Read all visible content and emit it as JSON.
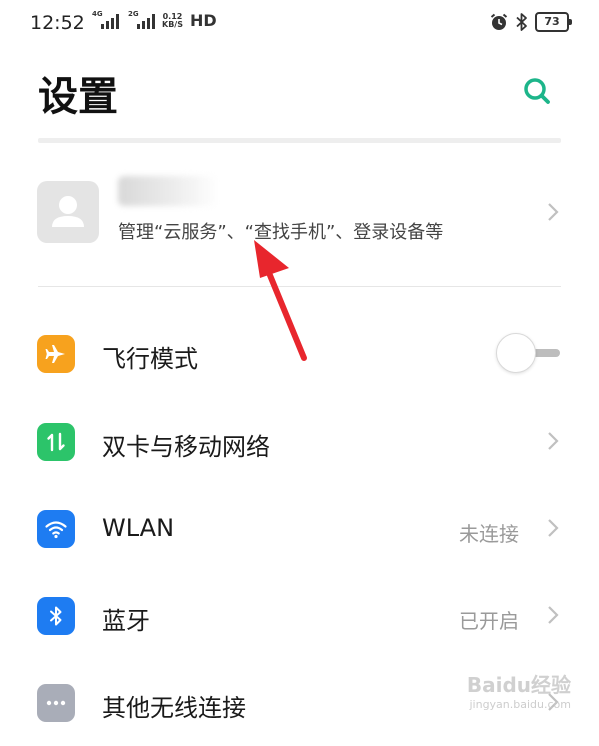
{
  "status_bar": {
    "time": "12:52",
    "sim1_tag": "4G",
    "sim2_tag": "2G",
    "speed_value": "0.12",
    "speed_unit": "KB/S",
    "hd": "HD",
    "battery": "73"
  },
  "header": {
    "title": "设置",
    "search_icon": "search-icon"
  },
  "account": {
    "avatar_icon": "person-icon",
    "subtitle": "管理“云服务”、“查找手机”、登录设备等"
  },
  "settings": [
    {
      "id": "airplane",
      "label": "飞行模式",
      "icon": "airplane-icon",
      "icon_color": "#f7a21e",
      "control": "toggle",
      "enabled": false
    },
    {
      "id": "sim",
      "label": "双卡与移动网络",
      "icon": "data-transfer-icon",
      "icon_color": "#2cc46a",
      "control": "chevron"
    },
    {
      "id": "wlan",
      "label": "WLAN",
      "status": "未连接",
      "icon": "wifi-icon",
      "icon_color": "#1e7cf2",
      "control": "chevron"
    },
    {
      "id": "bluetooth",
      "label": "蓝牙",
      "status": "已开启",
      "icon": "bluetooth-icon",
      "icon_color": "#1e7cf2",
      "control": "chevron"
    },
    {
      "id": "other",
      "label": "其他无线连接",
      "icon": "more-icon",
      "icon_color": "#a9adb8",
      "control": "chevron"
    }
  ],
  "colors": {
    "accent": "#1db58a",
    "annotation_arrow": "#e8262d"
  },
  "watermark": {
    "main": "Baidu经验",
    "sub": "jingyan.baidu.com"
  }
}
